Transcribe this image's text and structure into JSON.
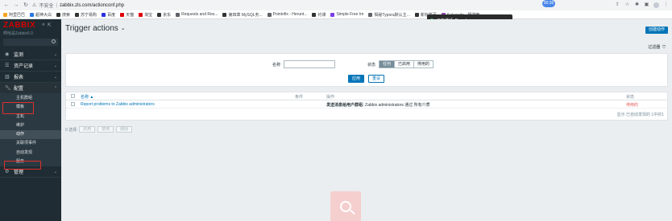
{
  "browser": {
    "security_label": "不安全",
    "url": "zabbix.zls.com/actionconf.php",
    "rec_time": "00:36",
    "bookmarks": [
      {
        "label": "阿里巴巴",
        "color": "#f5a623"
      },
      {
        "label": "超神大白",
        "color": "#2b78e4"
      },
      {
        "label": "搜索",
        "color": "#333333"
      },
      {
        "label": "苏宁易购",
        "color": "#333333"
      },
      {
        "label": "百度",
        "color": "#2932e1"
      },
      {
        "label": "天猫",
        "color": "#e00000"
      },
      {
        "label": "淘宝",
        "color": "#e00000"
      },
      {
        "label": "京东",
        "color": "#333333"
      },
      {
        "label": "Requests and Res...",
        "color": "#5f6368"
      },
      {
        "label": "第四章 MySQL务...",
        "color": "#333333"
      },
      {
        "label": "Pointofix - Herunt...",
        "color": "#5f6368"
      },
      {
        "label": "约课",
        "color": "#333333"
      },
      {
        "label": "Simple Free Im",
        "color": "#7b3fe4"
      },
      {
        "label": "揭秘Typora默认主...",
        "color": "#5f6368"
      },
      {
        "label": "新标签页",
        "color": "#333333"
      },
      {
        "label": "Sakuraito - 畅游晚...",
        "color": "#8e44ad"
      }
    ],
    "toast_text": "正在讲话: Poundc"
  },
  "sidebar": {
    "logo": "ZABBIX",
    "server_name": "啊哈是Zabbix5.0",
    "menu": [
      {
        "label": "监测",
        "icon": "eye-icon"
      },
      {
        "label": "资产记录",
        "icon": "list-icon"
      },
      {
        "label": "报表",
        "icon": "chart-icon"
      },
      {
        "label": "配置",
        "icon": "wrench-icon"
      }
    ],
    "config_sub": [
      "主机群组",
      "模板",
      "主机",
      "维护",
      "动作",
      "关联项事件",
      "自动发现",
      "服务"
    ],
    "admin": {
      "label": "管理",
      "icon": "gear-icon"
    }
  },
  "main": {
    "title": "Trigger actions",
    "create_button": "创建动作",
    "filter_label": "过滤器",
    "filter": {
      "name_label": "名称",
      "status_label": "状态",
      "status_options": [
        "任何",
        "已启用",
        "停用的"
      ],
      "status_selected": 0,
      "apply": "应用",
      "reset": "重设"
    },
    "table": {
      "headers": {
        "name": "名称 ▲",
        "conditions": "条件",
        "operations": "操作",
        "status": "状态"
      },
      "rows": [
        {
          "name": "Report problems to Zabbix administrators",
          "conditions": "",
          "operations_bold": "发送消息给用户群组:",
          "operations_rest": " Zabbix administrators 通过 所有介质",
          "status": "停用的"
        }
      ],
      "count_text": "显示 已自动发现的 1中的1"
    },
    "bulk": {
      "selected": "0 选择",
      "buttons": [
        "启用",
        "禁用",
        "删除"
      ]
    }
  }
}
